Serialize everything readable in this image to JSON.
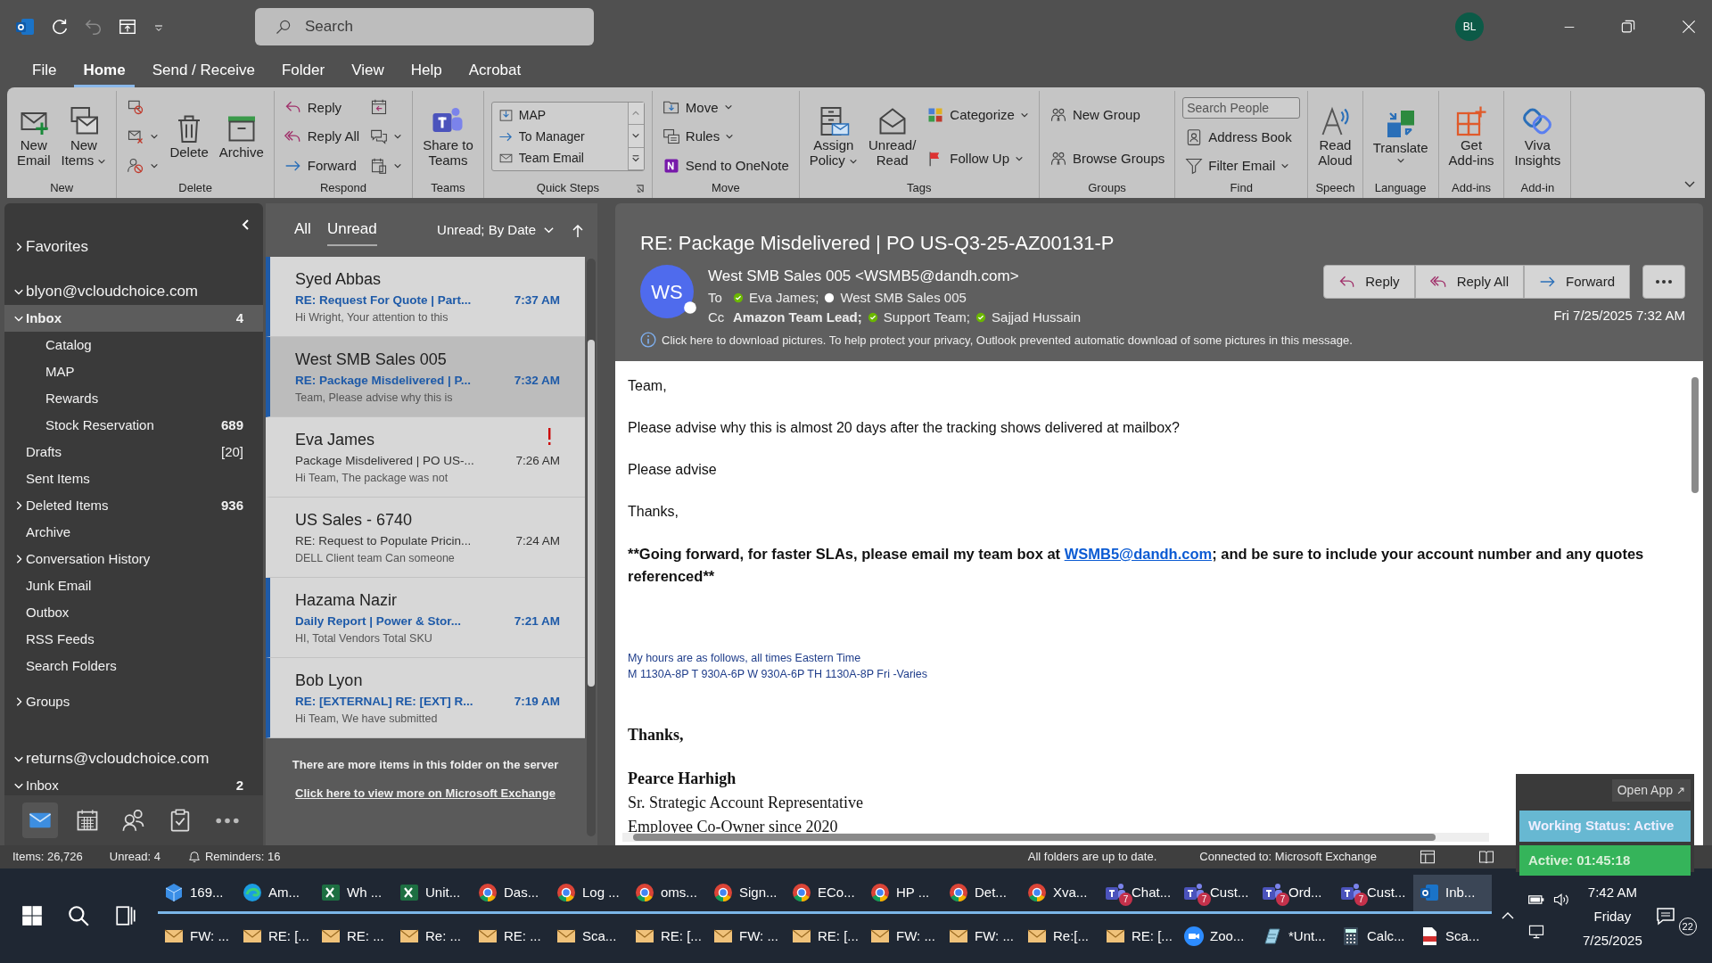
{
  "title_bar": {
    "search": {
      "placeholder": "Search"
    },
    "avatar": "BL"
  },
  "menu_tabs": [
    {
      "label": "File",
      "selected": false
    },
    {
      "label": "Home",
      "selected": true
    },
    {
      "label": "Send / Receive",
      "selected": false
    },
    {
      "label": "Folder",
      "selected": false
    },
    {
      "label": "View",
      "selected": false
    },
    {
      "label": "Help",
      "selected": false
    },
    {
      "label": "Acrobat",
      "selected": false
    }
  ],
  "ribbon": {
    "groups": [
      {
        "label": "New",
        "columns": [
          [
            {
              "kind": "large",
              "lines": [
                "New",
                "Email"
              ],
              "dropdown": false
            }
          ],
          [
            {
              "kind": "large",
              "lines": [
                "New",
                "Items"
              ],
              "dropdown": true
            }
          ]
        ]
      },
      {
        "label": "Delete",
        "columns": [
          [
            {
              "kind": "icon",
              "dropdown": false
            },
            {
              "kind": "icon",
              "dropdown": true
            },
            {
              "kind": "icon",
              "dropdown": true
            }
          ],
          [
            {
              "kind": "large",
              "lines": [
                "Delete"
              ],
              "dropdown": false
            }
          ],
          [
            {
              "kind": "large",
              "lines": [
                "Archive"
              ],
              "dropdown": false
            }
          ]
        ]
      },
      {
        "label": "Respond",
        "columns": [
          [
            {
              "kind": "small",
              "label": "Reply",
              "dropdown": false
            },
            {
              "kind": "small",
              "label": "Reply All",
              "dropdown": false
            },
            {
              "kind": "small",
              "label": "Forward",
              "dropdown": false
            }
          ],
          [
            {
              "kind": "icon",
              "dropdown": false
            },
            {
              "kind": "icon",
              "dropdown": true
            },
            {
              "kind": "icon",
              "dropdown": true
            }
          ]
        ]
      },
      {
        "label": "Teams",
        "columns": [
          [
            {
              "kind": "large",
              "lines": [
                "Share to",
                "Teams"
              ],
              "dropdown": false
            }
          ]
        ]
      },
      {
        "label": "Quick Steps",
        "launcher": true,
        "columns": [
          [
            {
              "kind": "quicksteps",
              "steps": [
                "MAP",
                "To Manager",
                "Team Email"
              ]
            }
          ]
        ]
      },
      {
        "label": "Move",
        "columns": [
          [
            {
              "kind": "small",
              "label": "Move",
              "dropdown": true
            },
            {
              "kind": "small",
              "label": "Rules",
              "dropdown": true
            },
            {
              "kind": "small",
              "label": "Send to OneNote",
              "dropdown": false
            }
          ]
        ]
      },
      {
        "label": "Tags",
        "columns": [
          [
            {
              "kind": "large",
              "lines": [
                "Assign",
                "Policy"
              ],
              "dropdown": true
            }
          ],
          [
            {
              "kind": "large",
              "lines": [
                "Unread/",
                "Read"
              ],
              "dropdown": false
            }
          ],
          [
            {
              "kind": "small",
              "label": "Categorize",
              "dropdown": true
            },
            {
              "kind": "small",
              "label": "Follow Up",
              "dropdown": true
            }
          ]
        ]
      },
      {
        "label": "Groups",
        "columns": [
          [
            {
              "kind": "small",
              "label": "New Group",
              "dropdown": false
            },
            {
              "kind": "small",
              "label": "Browse Groups",
              "dropdown": false
            }
          ]
        ]
      },
      {
        "label": "Find",
        "columns": [
          [
            {
              "kind": "field",
              "placeholder": "Search People"
            },
            {
              "kind": "small",
              "label": "Address Book",
              "dropdown": false
            },
            {
              "kind": "small",
              "label": "Filter Email",
              "dropdown": true
            }
          ]
        ]
      },
      {
        "label": "Speech",
        "columns": [
          [
            {
              "kind": "large",
              "lines": [
                "Read",
                "Aloud"
              ],
              "dropdown": false
            }
          ]
        ]
      },
      {
        "label": "Language",
        "columns": [
          [
            {
              "kind": "large",
              "lines": [
                "Translate"
              ],
              "dropdown": true
            }
          ]
        ]
      },
      {
        "label": "Add-ins",
        "columns": [
          [
            {
              "kind": "large",
              "lines": [
                "Get",
                "Add-ins"
              ],
              "dropdown": false
            }
          ]
        ]
      },
      {
        "label": "Add-in",
        "columns": [
          [
            {
              "kind": "large",
              "lines": [
                "Viva",
                "Insights"
              ],
              "dropdown": false
            }
          ]
        ]
      }
    ]
  },
  "folder_pane": {
    "favorites": {
      "label": "Favorites",
      "expanded": false
    },
    "accounts": [
      {
        "label": "blyon@vcloudchoice.com",
        "expanded": true,
        "folders": [
          {
            "label": "Inbox",
            "count": "4",
            "count_bold": true,
            "selected": true,
            "expanded": true,
            "children": [
              {
                "label": "Catalog",
                "selected": false
              },
              {
                "label": "MAP",
                "selected": false
              },
              {
                "label": "Rewards",
                "selected": false
              },
              {
                "label": "Stock Reservation",
                "count": "689",
                "count_bold": true,
                "selected": false
              }
            ]
          },
          {
            "label": "Drafts",
            "count": "[20]",
            "count_bold": false,
            "selected": false
          },
          {
            "label": "Sent Items",
            "selected": false
          },
          {
            "label": "Deleted Items",
            "count": "936",
            "count_bold": true,
            "selected": false,
            "expanded": false
          },
          {
            "label": "Archive",
            "selected": false
          },
          {
            "label": "Conversation History",
            "selected": false,
            "expanded": false
          },
          {
            "label": "Junk Email",
            "selected": false
          },
          {
            "label": "Outbox",
            "selected": false
          },
          {
            "label": "RSS Feeds",
            "selected": false
          },
          {
            "label": "Search Folders",
            "selected": false
          }
        ],
        "groups": {
          "label": "Groups",
          "expanded": false
        }
      },
      {
        "label": "returns@vcloudchoice.com",
        "expanded": true,
        "folders": [
          {
            "label": "Inbox",
            "count": "2",
            "count_bold": true,
            "selected": false,
            "expanded": true
          }
        ]
      }
    ],
    "nav": [
      {
        "kind": "mail",
        "selected": true
      },
      {
        "kind": "calendar",
        "selected": false
      },
      {
        "kind": "people",
        "selected": false
      },
      {
        "kind": "tasks",
        "selected": false
      },
      {
        "kind": "more",
        "selected": false
      }
    ]
  },
  "message_list": {
    "filters": [
      {
        "label": "All",
        "selected": false
      },
      {
        "label": "Unread",
        "selected": true
      }
    ],
    "sort": "Unread; By Date",
    "messages": [
      {
        "sender": "Syed Abbas",
        "subject": "RE: Request For Quote | Part...",
        "preview": "Hi Wright,  Your attention to this",
        "time": "7:37 AM",
        "unread": true,
        "selected": false,
        "important": false
      },
      {
        "sender": "West SMB Sales 005",
        "subject": "RE: Package Misdelivered | P...",
        "preview": "Team,  Please advise why this is",
        "time": "7:32 AM",
        "unread": true,
        "selected": true,
        "important": false
      },
      {
        "sender": "Eva James",
        "subject": "Package Misdelivered | PO US-...",
        "preview": "Hi Team,   The package was not",
        "time": "7:26 AM",
        "unread": false,
        "selected": false,
        "important": true
      },
      {
        "sender": "US Sales - 6740",
        "subject": "RE: Request to Populate Pricin...",
        "preview": "DELL Client team  Can someone",
        "time": "7:24 AM",
        "unread": false,
        "selected": false,
        "important": false
      },
      {
        "sender": "Hazama Nazir",
        "subject": "Daily Report | Power & Stor...",
        "preview": "HI,  Total Vendors  Total SKU",
        "time": "7:21 AM",
        "unread": true,
        "selected": false,
        "important": false
      },
      {
        "sender": "Bob Lyon",
        "subject": "RE: [EXTERNAL] RE: [EXT] R...",
        "preview": "Hi Team,  We have submitted",
        "time": "7:19 AM",
        "unread": true,
        "selected": false,
        "important": false
      }
    ],
    "footer": {
      "text": "There are more items in this folder on the server",
      "link": "Click here to view more on Microsoft Exchange"
    }
  },
  "reading_pane": {
    "subject": "RE: Package Misdelivered | PO US-Q3-25-AZ00131-P",
    "sender": {
      "initials": "WS",
      "name": "West SMB Sales 005 <WSMB5@dandh.com>",
      "color": "#ffffff"
    },
    "to_label": "To",
    "to": [
      {
        "name": "Eva James;",
        "color": "#6bb700",
        "bold": false
      },
      {
        "name": "West SMB Sales 005",
        "color": "#ffffff",
        "bold": false
      }
    ],
    "cc_label": "Cc",
    "cc": [
      {
        "name": "Amazon Team Lead;",
        "bold": true
      },
      {
        "name": "Support Team;",
        "color": "#6bb700",
        "bold": false
      },
      {
        "name": "Sajjad Hussain",
        "color": "#6bb700",
        "bold": false
      }
    ],
    "actions": [
      {
        "label": "Reply",
        "kind": "reply"
      },
      {
        "label": "Reply All",
        "kind": "reply-all"
      },
      {
        "label": "Forward",
        "kind": "forward"
      }
    ],
    "date": "Fri 7/25/2025 7:32 AM",
    "info": "Click here to download pictures. To help protect your privacy, Outlook prevented automatic download of some pictures in this message.",
    "body": [
      {
        "kind": "text",
        "text": "Team,"
      },
      {
        "kind": "text",
        "text": "Please advise why this is almost 20 days after the tracking shows delivered at mailbox?"
      },
      {
        "kind": "text",
        "text": "Please advise"
      },
      {
        "kind": "text",
        "text": "Thanks,"
      },
      {
        "kind": "notice",
        "parts": [
          {
            "text": "**Going forward, for faster SLAs, please email my team box at "
          },
          {
            "link": "WSMB5@dandh.com"
          },
          {
            "text": "; and be sure to include your account number and any quotes referenced**"
          }
        ]
      },
      {
        "kind": "hours",
        "text": "My hours are as follows,  all times Eastern Time"
      },
      {
        "kind": "hours",
        "text": "M 1130A-8P T 930A-6P W 930A-6P TH 1130A-8P Fri -Varies"
      },
      {
        "kind": "sig-bold",
        "text": "Thanks,"
      },
      {
        "kind": "sig-bold",
        "text": "Pearce Harhigh"
      },
      {
        "kind": "sig",
        "text": "Sr. Strategic Account Representative"
      },
      {
        "kind": "sig",
        "text": "Employee Co-Owner since 2020"
      }
    ]
  },
  "status_bar": {
    "left": [
      {
        "text": "Items: 26,726",
        "kind": "plain"
      },
      {
        "text": "Unread: 4",
        "kind": "plain"
      },
      {
        "text": "Reminders: 16",
        "kind": "reminders"
      }
    ],
    "right": [
      "All folders are up to date.",
      "Connected to: Microsoft Exchange"
    ]
  },
  "widget": {
    "open_app": "Open App",
    "status": "Working Status: Active",
    "timer": "Active: 01:45:18"
  },
  "taskbar": {
    "top": [
      {
        "label": "169...",
        "kind": "files",
        "selected": false
      },
      {
        "label": "Am...",
        "kind": "edge",
        "selected": false
      },
      {
        "label": "Wh ...",
        "kind": "excel",
        "selected": false
      },
      {
        "label": "Unit...",
        "kind": "excel",
        "selected": false
      },
      {
        "label": "Das...",
        "kind": "chrome",
        "selected": false
      },
      {
        "label": "Log ...",
        "kind": "chrome",
        "selected": false
      },
      {
        "label": "oms...",
        "kind": "chrome",
        "selected": false
      },
      {
        "label": "Sign...",
        "kind": "chrome",
        "selected": false
      },
      {
        "label": "ECo...",
        "kind": "chrome",
        "selected": false
      },
      {
        "label": "HP ...",
        "kind": "chrome",
        "selected": false
      },
      {
        "label": "Det...",
        "kind": "chrome",
        "selected": false
      },
      {
        "label": "Xva...",
        "kind": "chrome",
        "selected": false
      },
      {
        "label": "Chat...",
        "kind": "teams",
        "badge": "7",
        "selected": false
      },
      {
        "label": "Cust...",
        "kind": "teams",
        "badge": "7",
        "selected": false
      },
      {
        "label": "Ord...",
        "kind": "teams",
        "badge": "7",
        "selected": false
      },
      {
        "label": "Cust...",
        "kind": "teams",
        "badge": "7",
        "selected": false
      },
      {
        "label": "Inb...",
        "kind": "outlook",
        "selected": true
      }
    ],
    "bottom": [
      {
        "label": "FW: ...",
        "kind": "mail",
        "selected": false
      },
      {
        "label": "RE: [...",
        "kind": "mail",
        "selected": false
      },
      {
        "label": "RE: ...",
        "kind": "mail",
        "selected": false
      },
      {
        "label": "Re: ...",
        "kind": "mail",
        "selected": false
      },
      {
        "label": "RE: ...",
        "kind": "mail",
        "selected": false
      },
      {
        "label": "Sca...",
        "kind": "mail",
        "selected": false
      },
      {
        "label": "RE: [...",
        "kind": "mail",
        "selected": false
      },
      {
        "label": "FW: ...",
        "kind": "mail",
        "selected": false
      },
      {
        "label": "RE: [...",
        "kind": "mail",
        "selected": false
      },
      {
        "label": "FW: ...",
        "kind": "mail",
        "selected": false
      },
      {
        "label": "FW: ...",
        "kind": "mail",
        "selected": false
      },
      {
        "label": "Re:[...",
        "kind": "mail",
        "selected": false
      },
      {
        "label": "RE: [...",
        "kind": "mail",
        "selected": false
      },
      {
        "label": "Zoo...",
        "kind": "zoom",
        "selected": false
      },
      {
        "label": "*Unt...",
        "kind": "notepad",
        "selected": false
      },
      {
        "label": "Calc...",
        "kind": "calc",
        "selected": false
      },
      {
        "label": "Sca...",
        "kind": "pdf",
        "selected": false
      }
    ],
    "tray": {
      "time": "7:42 AM",
      "day": "Friday",
      "date": "7/25/2025",
      "notifications": "22"
    }
  }
}
